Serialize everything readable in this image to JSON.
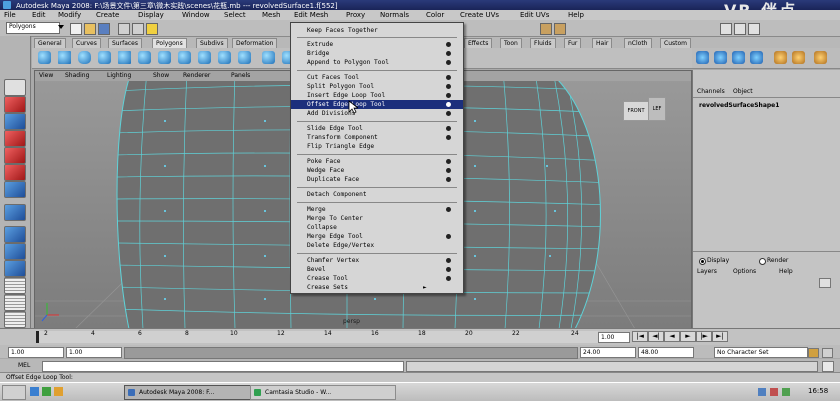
{
  "window": {
    "title": "Autodesk Maya 2008: F:\\场景文件\\第三章\\微木实践\\scenes\\花瓶.mb  ---  revolvedSurface1.f[552]",
    "watermark": "VR-伴点"
  },
  "menubar": [
    "File",
    "Edit",
    "Modify",
    "Create",
    "Display",
    "Window",
    "Select",
    "Mesh",
    "Edit Mesh",
    "Proxy",
    "Normals",
    "Color",
    "Create UVs",
    "Edit UVs",
    "Help"
  ],
  "status_line": {
    "mode": "Polygons"
  },
  "shelf_tabs": [
    {
      "label": "General",
      "active": false
    },
    {
      "label": "Curves",
      "active": false
    },
    {
      "label": "Surfaces",
      "active": false
    },
    {
      "label": "Polygons",
      "active": true
    },
    {
      "label": "Subdivs",
      "active": false
    },
    {
      "label": "Deformation",
      "active": false
    },
    {
      "label": "Effects",
      "active": false
    },
    {
      "label": "Toon",
      "active": false
    },
    {
      "label": "Fluids",
      "active": false
    },
    {
      "label": "Fur",
      "active": false
    },
    {
      "label": "Hair",
      "active": false
    },
    {
      "label": "nCloth",
      "active": false
    },
    {
      "label": "Custom",
      "active": false
    }
  ],
  "viewport": {
    "menu": [
      "View",
      "Shading",
      "Lighting",
      "Show",
      "Renderer",
      "Panels"
    ],
    "view_cube": {
      "front": "FRONT",
      "side": "LEF"
    },
    "camera_label": "persp"
  },
  "edit_mesh_menu": {
    "items": [
      {
        "label": "Keep Faces Together",
        "option": false
      },
      {
        "sep": true
      },
      {
        "label": "Extrude",
        "option": true
      },
      {
        "label": "Bridge",
        "option": true
      },
      {
        "label": "Append to Polygon Tool",
        "option": true
      },
      {
        "sep": true
      },
      {
        "label": "Cut Faces Tool",
        "option": true
      },
      {
        "label": "Split Polygon Tool",
        "option": true
      },
      {
        "label": "Insert Edge Loop Tool",
        "option": true
      },
      {
        "label": "Offset Edge Loop Tool",
        "option": true,
        "highlighted": true
      },
      {
        "label": "Add Divisions",
        "option": true
      },
      {
        "sep": true
      },
      {
        "label": "Slide Edge Tool",
        "option": true
      },
      {
        "label": "Transform Component",
        "option": true
      },
      {
        "label": "Flip Triangle Edge",
        "option": false
      },
      {
        "sep": true
      },
      {
        "label": "Poke Face",
        "option": true
      },
      {
        "label": "Wedge Face",
        "option": true
      },
      {
        "label": "Duplicate Face",
        "option": true
      },
      {
        "sep": true
      },
      {
        "label": "Detach Component",
        "option": false
      },
      {
        "sep": true
      },
      {
        "label": "Merge",
        "option": true
      },
      {
        "label": "Merge To Center",
        "option": false
      },
      {
        "label": "Collapse",
        "option": false
      },
      {
        "label": "Merge Edge Tool",
        "option": true
      },
      {
        "label": "Delete Edge/Vertex",
        "option": false
      },
      {
        "sep": true
      },
      {
        "label": "Chamfer Vertex",
        "option": true
      },
      {
        "label": "Bevel",
        "option": true
      },
      {
        "label": "Crease Tool",
        "option": true
      },
      {
        "label": "Crease Sets",
        "option": false,
        "submenu": true
      }
    ]
  },
  "channel_box": {
    "tabs": [
      "Channels",
      "Object"
    ],
    "object_name": "revolvedSurfaceShape1",
    "display_radio": "Display",
    "render_radio": "Render",
    "layer_menu": [
      "Layers",
      "Options",
      "Help"
    ]
  },
  "timeline": {
    "ticks": [
      "2",
      "4",
      "6",
      "8",
      "10",
      "12",
      "14",
      "16",
      "18",
      "20",
      "22",
      "24"
    ],
    "current_frame": "1.00"
  },
  "range": {
    "start": "1.00",
    "playback_start": "1.00",
    "playback_end": "24.00",
    "end": "48.00",
    "character_set": "No Character Set"
  },
  "command_line": {
    "label": "MEL"
  },
  "help_line": {
    "text": "Offset Edge Loop Tool:"
  },
  "taskbar": {
    "items": [
      {
        "label": "Autodesk Maya 2008: F...",
        "active": true
      },
      {
        "label": "Camtasia Studio - W...",
        "active": false
      }
    ],
    "clock": "16:58"
  }
}
